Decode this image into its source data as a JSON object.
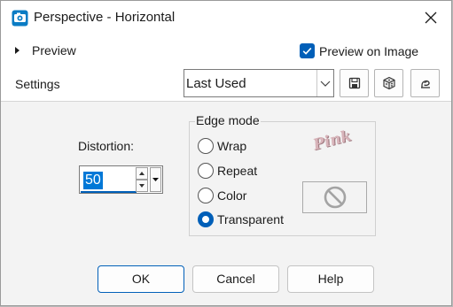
{
  "window": {
    "title": "Perspective - Horizontal"
  },
  "preview": {
    "label": "Preview",
    "preview_on_image_label": "Preview on Image",
    "preview_on_image_checked": true
  },
  "settings": {
    "label": "Settings",
    "preset_value": "Last Used"
  },
  "distortion": {
    "label": "Distortion:",
    "value": "50"
  },
  "edge_mode": {
    "title": "Edge mode",
    "options": [
      {
        "label": "Wrap",
        "selected": false
      },
      {
        "label": "Repeat",
        "selected": false
      },
      {
        "label": "Color",
        "selected": false
      },
      {
        "label": "Transparent",
        "selected": true
      }
    ]
  },
  "watermark": {
    "text": "Pink"
  },
  "buttons": {
    "ok": "OK",
    "cancel": "Cancel",
    "help": "Help"
  },
  "colors": {
    "accent": "#005fb8",
    "dialog_bg": "#f3f3f3",
    "title_bg": "#ffffff",
    "app_icon": "#0a7cc4"
  },
  "icons": {
    "app": "app-icon",
    "close": "close-icon",
    "expand": "triangle-right-icon",
    "save": "save-preset-icon",
    "reset": "reset-cube-icon",
    "randomize": "randomize-icon",
    "none_color": "no-symbol-icon"
  }
}
